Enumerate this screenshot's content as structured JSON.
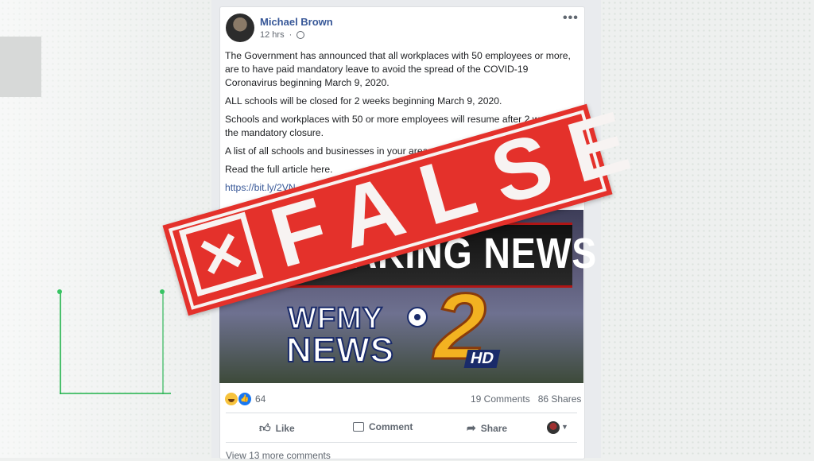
{
  "post": {
    "author": "Michael Brown",
    "time": "12 hrs",
    "more": "•••",
    "paragraphs": [
      "The Government has announced that all workplaces with 50 employees or more, are to have paid mandatory leave to avoid the spread of the COVID-19 Coronavirus beginning March 9, 2020.",
      "ALL schools will be closed for 2 weeks beginning March 9, 2020.",
      "Schools and workplaces with 50 or more employees will resume after 2 weeks of the mandatory closure.",
      "A list of all schools and businesses in your area can be found in this link.",
      "Read the full article here."
    ],
    "link": "https://bit.ly/2VN...",
    "reaction_count": "64",
    "comments": "19 Comments",
    "shares": "86 Shares",
    "actions": {
      "like": "Like",
      "comment": "Comment",
      "share": "Share"
    },
    "view_more": "View 13 more comments"
  },
  "preview": {
    "banner": "BREAKING NEWS",
    "station_top": "WFMY",
    "station_bottom": "NEWS",
    "channel": "2",
    "hd": "HD"
  },
  "stamp": {
    "word": "FALSE",
    "x_glyph": "✕",
    "color": "#e4312b"
  }
}
